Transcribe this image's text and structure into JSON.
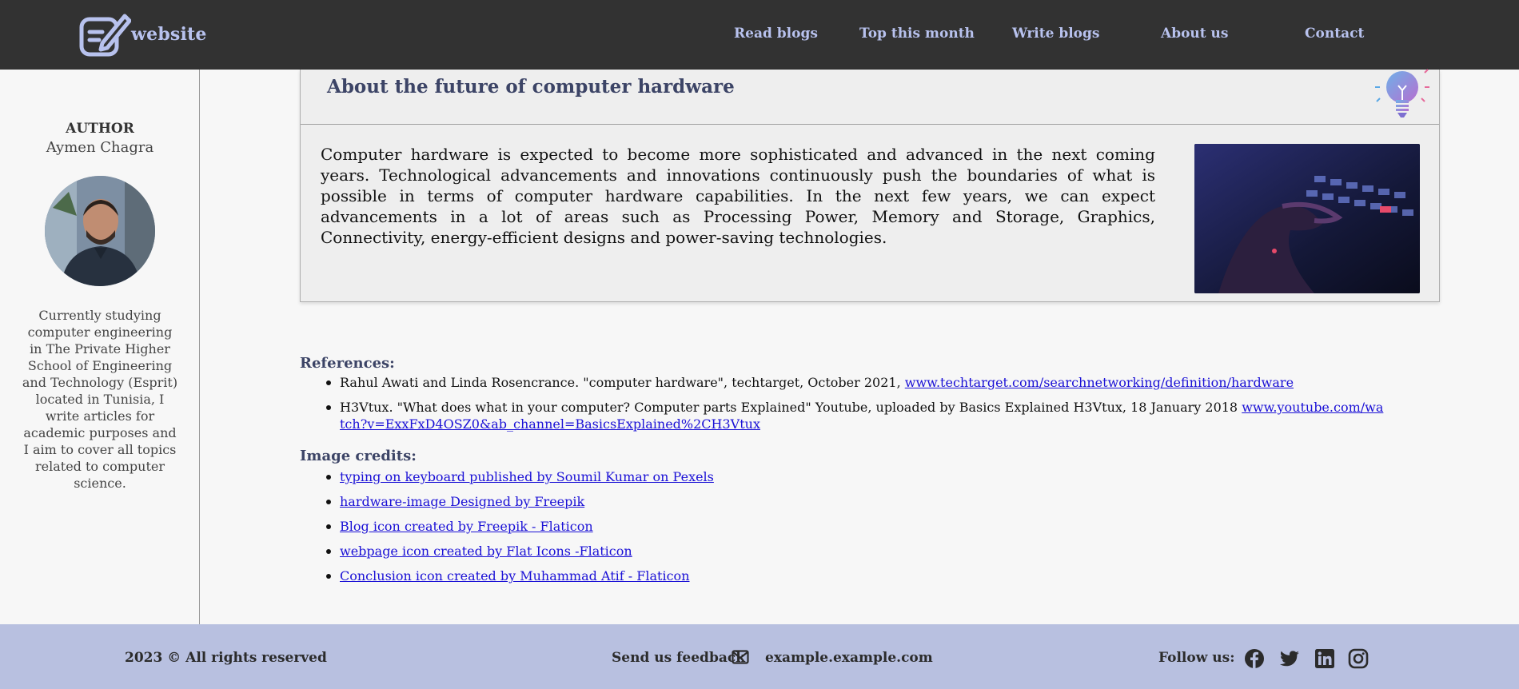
{
  "header": {
    "logo_text": "website",
    "nav": [
      "Read blogs",
      "Top this month",
      "Write blogs",
      "About us",
      "Contact"
    ]
  },
  "sidebar": {
    "author_label": "AUTHOR",
    "author_name": "Aymen Chagra",
    "bio": "Currently studying computer engineering in The Private Higher School of Engineering and Technology (Esprit) located in Tunisia, I write articles for academic purposes and I aim to cover all topics related to computer science."
  },
  "article": {
    "title": "About the future of computer hardware",
    "body": "Computer hardware is expected to become more sophisticated and advanced in the next coming years. Technological advancements and innovations continuously push the boundaries of what is possible in terms of computer hardware capabilities. In the next few years, we can expect advancements in a lot of areas such as Processing Power, Memory and Storage, Graphics, Connectivity, energy-efficient designs and power-saving technologies."
  },
  "references": {
    "title": "References:",
    "items": [
      {
        "text": "Rahul Awati and Linda Rosencrance. \"computer hardware\", techtarget, October 2021, ",
        "link": "www.techtarget.com/searchnetworking/definition/hardware"
      },
      {
        "text": "H3Vtux. \"What does what in your computer? Computer parts Explained\" Youtube, uploaded by Basics Explained H3Vtux, 18 January 2018 ",
        "link": "www.youtube.com/watch?v=ExxFxD4OSZ0&ab_channel=BasicsExplained%2CH3Vtux"
      }
    ]
  },
  "credits": {
    "title": "Image credits:",
    "items": [
      "typing on keyboard published by Soumil Kumar on Pexels",
      "hardware-image Designed by Freepik",
      "Blog icon created by Freepik - Flaticon",
      "webpage icon created by Flat Icons -Flaticon",
      "Conclusion icon created by Muhammad Atif - Flaticon"
    ]
  },
  "footer": {
    "copyright": "2023 © All rights reserved",
    "feedback": "Send us feedback",
    "email": "example.example.com",
    "follow": "Follow us:",
    "social_icons": [
      "facebook-icon",
      "twitter-icon",
      "linkedin-icon",
      "instagram-icon"
    ]
  },
  "colors": {
    "header_bg": "#323232",
    "nav_text": "#b8c2ee",
    "footer_bg": "#b8c0e0",
    "link": "#1a10d6",
    "title": "#3c4466"
  }
}
